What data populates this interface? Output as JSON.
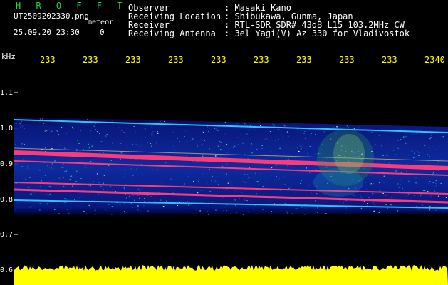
{
  "app_title": "H R O F F T",
  "file_name": "UT2509202330.png",
  "meteor_label": "meteor",
  "datetime": "25.09.20 23:30",
  "count": "0",
  "header": {
    "observer_label": "Observer",
    "observer_value": ": Masaki Kano",
    "location_label": "Receiving Location",
    "location_value": ": Shibukawa, Gunma, Japan",
    "receiver_label": "Receiver",
    "receiver_value": ": RTL-SDR SDR# 43dB L15 103.2MHz CW",
    "antenna_label": "Receiving Antenna",
    "antenna_value": ": 3el Yagi(V) Az 330 for Vladivostok"
  },
  "y_unit": "kHz",
  "y_ticks": [
    "1.1",
    "1.0",
    "0.9",
    "0.8",
    "0.7",
    "0.6"
  ],
  "x_ticks": [
    "233",
    "233",
    "233",
    "233",
    "233",
    "233",
    "233",
    "233",
    "233",
    "2340"
  ],
  "colors": {
    "title": "#25d35a",
    "tick_x": "#ffff00",
    "echo_band": "#ff3a7a",
    "noise_bottom": "#ffff00"
  }
}
